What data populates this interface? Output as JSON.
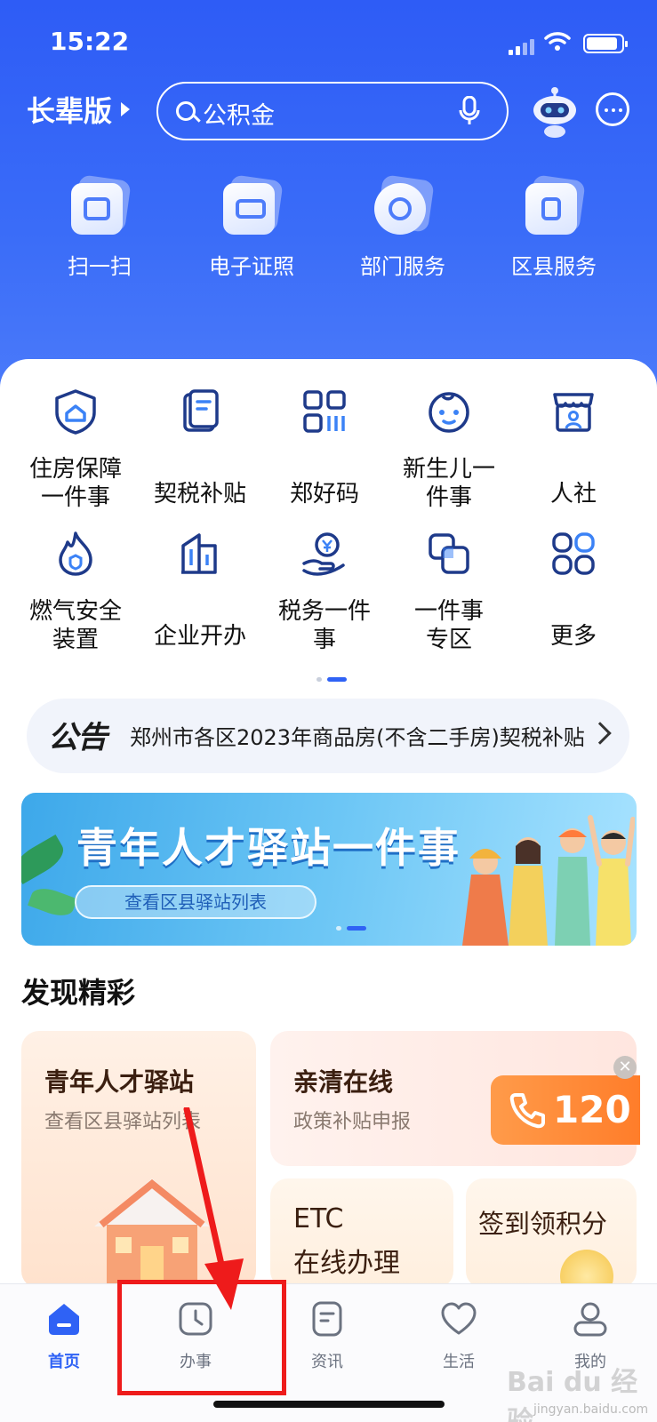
{
  "status": {
    "time": "15:22"
  },
  "header": {
    "elder_mode": "长辈版",
    "search_placeholder": "公积金"
  },
  "quick_actions": [
    {
      "label": "扫一扫",
      "icon": "scan-icon"
    },
    {
      "label": "电子证照",
      "icon": "id-card-icon"
    },
    {
      "label": "部门服务",
      "icon": "department-icon"
    },
    {
      "label": "区县服务",
      "icon": "district-icon"
    }
  ],
  "services": [
    {
      "line1": "住房保障",
      "line2": "一件事",
      "icon": "house-shield-icon"
    },
    {
      "line1": "契税补贴",
      "line2": "",
      "icon": "document-icon"
    },
    {
      "line1": "郑好码",
      "line2": "",
      "icon": "qr-code-icon"
    },
    {
      "line1": "新生儿一",
      "line2": "件事",
      "icon": "baby-icon"
    },
    {
      "line1": "人社",
      "line2": "",
      "icon": "shop-person-icon"
    },
    {
      "line1": "燃气安全",
      "line2": "装置",
      "icon": "flame-icon"
    },
    {
      "line1": "企业开办",
      "line2": "",
      "icon": "building-icon"
    },
    {
      "line1": "税务一件",
      "line2": "事",
      "icon": "tax-hand-icon"
    },
    {
      "line1": "一件事",
      "line2": "专区",
      "icon": "overlap-squares-icon"
    },
    {
      "line1": "更多",
      "line2": "",
      "icon": "grid-more-icon"
    }
  ],
  "notice": {
    "tag": "公告",
    "text": "郑州市各区2023年商品房(不含二手房)契税补贴"
  },
  "banner": {
    "title": "青年人才驿站一件事",
    "button": "查看区县驿站列表"
  },
  "discover": {
    "title": "发现精彩",
    "cards": [
      {
        "title": "青年人才驿站",
        "subtitle": "查看区县驿站列表"
      },
      {
        "title": "亲清在线",
        "subtitle": "政策补贴申报",
        "badge": "120"
      },
      {
        "title": "ETC",
        "title2": "在线办理"
      },
      {
        "title": "签到领积分"
      }
    ]
  },
  "tabs": [
    {
      "label": "首页",
      "icon": "home-icon",
      "active": true
    },
    {
      "label": "办事",
      "icon": "clock-icon",
      "active": false
    },
    {
      "label": "资讯",
      "icon": "news-icon",
      "active": false
    },
    {
      "label": "生活",
      "icon": "heart-icon",
      "active": false
    },
    {
      "label": "我的",
      "icon": "user-icon",
      "active": false
    }
  ],
  "watermark": {
    "brand": "Bai du 经验",
    "domain": "jingyan.baidu.com"
  },
  "colors": {
    "primary": "#2f62f5",
    "highlight": "#ee1b1b",
    "accent": "#ff7d2a"
  }
}
